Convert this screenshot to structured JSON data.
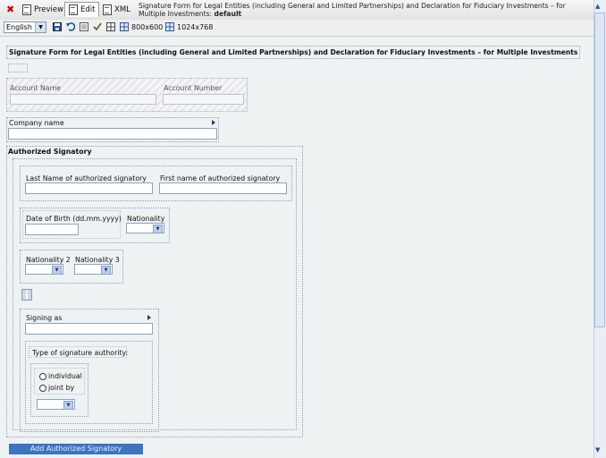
{
  "toolbar": {
    "preview_label": "Preview",
    "edit_label": "Edit",
    "xml_label": "XML",
    "title_text": "Signature Form for Legal Entities (including General and Limited Partnerships) and Declaration for Fiduciary Investments – for Multiple Investments:",
    "title_state": "default"
  },
  "toolbar2": {
    "language": "English",
    "size1": "800x600",
    "size2": "1024x768"
  },
  "form": {
    "heading": "Signature Form for Legal Entities (including General and Limited Partnerships) and Declaration for Fiduciary Investments – for Multiple Investments",
    "account_name_label": "Account Name",
    "account_number_label": "Account Number",
    "company_name_label": "Company name",
    "authorized_signatory_label": "Authorized Signatory",
    "last_name_label": "Last Name of authorized signatory",
    "first_name_label": "First name of authorized signatory",
    "dob_label": "Date of Birth (dd.mm.yyyy)",
    "nationality_label": "Nationality",
    "nationality2_label": "Nationality 2",
    "nationality3_label": "Nationality 3",
    "signing_as_label": "Signing as",
    "signature_type_label": "Type of signature authority:",
    "individual_label": "individual",
    "joint_label": "joint by",
    "add_button_label": "Add Authorized Signatory"
  },
  "icons": [
    "close-icon",
    "preview-icon",
    "edit-icon",
    "xml-icon",
    "save-icon",
    "undo-icon",
    "grid-icon",
    "check-icon",
    "layout-icon",
    "layout-800-icon",
    "layout-1024-icon"
  ]
}
